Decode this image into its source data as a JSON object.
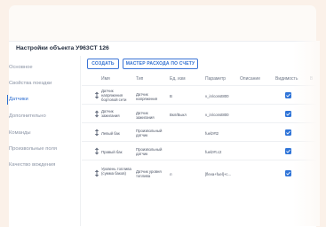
{
  "page": {
    "title": "Настройки объекта У963СТ 126"
  },
  "sidebar": {
    "items": [
      {
        "label": "Основное",
        "active": false
      },
      {
        "label": "Свойства поездки",
        "active": false
      },
      {
        "label": "Датчики",
        "active": true
      },
      {
        "label": "Дополнительно",
        "active": false
      },
      {
        "label": "Команды",
        "active": false
      },
      {
        "label": "Произвольные поля",
        "active": false
      },
      {
        "label": "Качество вождения",
        "active": false
      }
    ]
  },
  "toolbar": {
    "create_label": "СОЗДАТЬ",
    "wizard_label": "МАСТЕР РАСХОДА ПО СЧЕТУ"
  },
  "table": {
    "columns": [
      "Имя",
      "Тип",
      "Ед. изм",
      "Параметр",
      "Описание",
      "Видимость",
      "В"
    ],
    "rows": [
      {
        "name": "Датчик напряжения бортовой сети",
        "type": "Датчик напряжения",
        "unit": "В",
        "param": "v_in/const800",
        "desc": "",
        "visible": true
      },
      {
        "name": "Датчик зажигания",
        "type": "Датчик зажигания",
        "unit": "Вкл/Выкл",
        "param": "v_in/const800",
        "desc": "",
        "visible": true
      },
      {
        "name": "Левый бак",
        "type": "Произвольный датчик",
        "unit": "",
        "param": "fuelz#t2",
        "desc": "",
        "visible": true
      },
      {
        "name": "Правый бак",
        "type": "Произвольный датчик",
        "unit": "",
        "param": "fuelz#t.c2",
        "desc": "",
        "visible": true
      },
      {
        "name": "Уровень топлива (сумма баков)",
        "type": "Датчик уровня топлива",
        "unit": "л",
        "param": "[fleva+fuel]+c...",
        "desc": "",
        "visible": true
      }
    ]
  }
}
